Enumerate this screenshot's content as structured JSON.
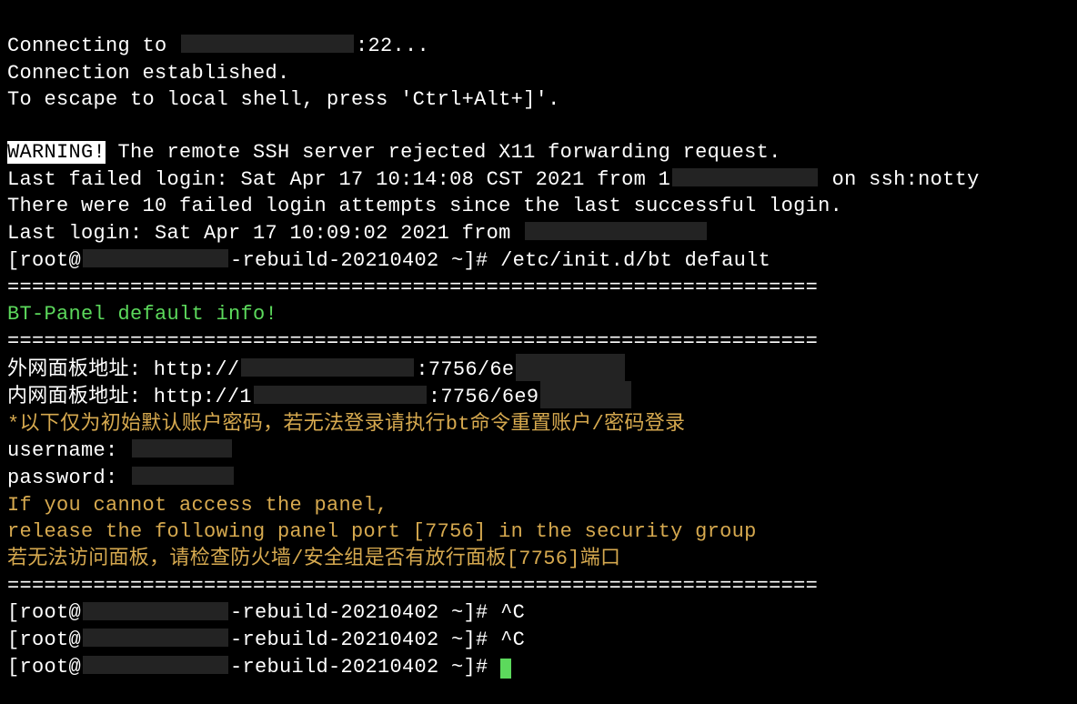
{
  "lines": {
    "connecting_before": "Connecting to ",
    "connecting_after": ":22...",
    "conn_established": "Connection established.",
    "escape": "To escape to local shell, press 'Ctrl+Alt+]'.",
    "warning_badge": "WARNING!",
    "warning_rest": " The remote SSH server rejected X11 forwarding request.",
    "last_failed_before": "Last failed login: Sat Apr 17 10:14:08 CST 2021 from 1",
    "last_failed_after": " on ssh:notty",
    "failed_attempts": "There were 10 failed login attempts since the last successful login.",
    "last_login": "Last login: Sat Apr 17 10:09:02 2021 from ",
    "prompt1_before": "[root@",
    "prompt1_mid": "-rebuild-20210402 ~]# ",
    "prompt1_cmd": "/etc/init.d/bt default",
    "sep": "==================================================================",
    "panel_info": "BT-Panel default info!",
    "ext_before": "外网面板地址: http://",
    "ext_after": ":7756/6e",
    "int_before": "内网面板地址: http://1",
    "int_after": ":7756/6e9",
    "cn_warning": "*以下仅为初始默认账户密码，若无法登录请执行bt命令重置账户/密码登录",
    "username_label": "username: ",
    "password_label": "password: ",
    "access_1": "If you cannot access the panel, ",
    "access_2": "release the following panel port [7756] in the security group",
    "access_cn": "若无法访问面板，请检查防火墙/安全组是否有放行面板[7756]端口",
    "prompt2_cmd": "^C",
    "prompt3_cmd": "^C",
    "prompt4_cmd": ""
  }
}
